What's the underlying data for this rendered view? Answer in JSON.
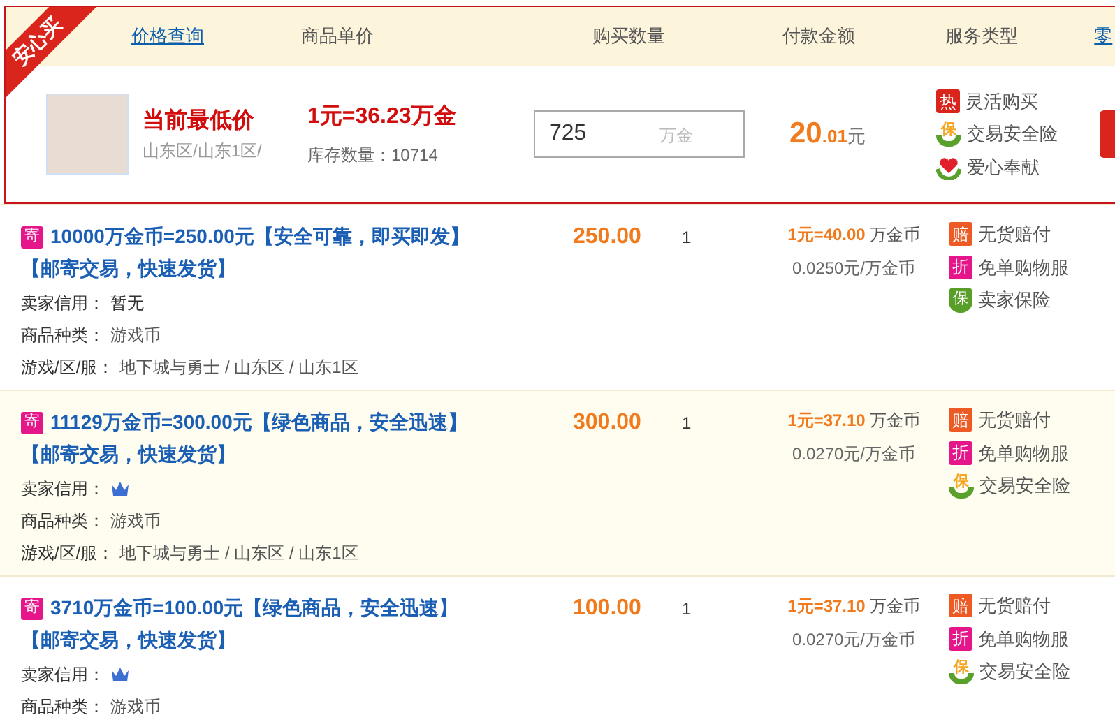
{
  "ribbon": "安心买",
  "header": {
    "columns": [
      {
        "label": "价格查询",
        "kind": "link"
      },
      {
        "label": "商品单价",
        "kind": "text"
      },
      {
        "label": "购买数量",
        "kind": "text"
      },
      {
        "label": "付款金额",
        "kind": "text"
      },
      {
        "label": "服务类型",
        "kind": "text"
      },
      {
        "label": "零",
        "kind": "link"
      }
    ]
  },
  "best_offer": {
    "title": "当前最低价",
    "region": "山东区/山东1区/",
    "rate": "1元=36.23万金",
    "stock_label": "库存数量：",
    "stock": "10714",
    "quantity": {
      "value": "725",
      "suffix": "万金"
    },
    "amount_integer": "20",
    "amount_decimal": ".01",
    "amount_unit": "元",
    "services": [
      {
        "kind": "square",
        "badge": "热",
        "color": "#d9251c",
        "label": "灵活购买"
      },
      {
        "kind": "hands",
        "badge": "保",
        "color": "#f5a623",
        "label": "交易安全险"
      },
      {
        "kind": "heart",
        "color": "#e0202a",
        "label": "爱心奉献"
      }
    ]
  },
  "listings": [
    {
      "badge": "寄",
      "title_lines": [
        "10000万金币=250.00元【安全可靠，即买即发】",
        "【邮寄交易，快速发货】"
      ],
      "credit_label": "卖家信用：",
      "credit": {
        "kind": "text",
        "text": "暂无"
      },
      "category_label": "商品种类：",
      "category": "游戏币",
      "server_label": "游戏/区/服：",
      "server": "地下城与勇士 / 山东区 / 山东1区",
      "price": "250.00",
      "quantity": "1",
      "rate_value": "1元=40.00",
      "rate_unit": "万金币",
      "unit_price": "0.0250元/万金币",
      "highlighted": false,
      "services": [
        {
          "kind": "square",
          "badge": "赔",
          "color": "#ee5a24",
          "label": "无货赔付"
        },
        {
          "kind": "square",
          "badge": "折",
          "color": "#e4168a",
          "label": "免单购物服"
        },
        {
          "kind": "shield",
          "badge": "保",
          "color": "#5a9e2a",
          "label": "卖家保险"
        }
      ]
    },
    {
      "badge": "寄",
      "title_lines": [
        "11129万金币=300.00元【绿色商品，安全迅速】",
        "【邮寄交易，快速发货】"
      ],
      "credit_label": "卖家信用：",
      "credit": {
        "kind": "crown"
      },
      "category_label": "商品种类：",
      "category": "游戏币",
      "server_label": "游戏/区/服：",
      "server": "地下城与勇士 / 山东区 / 山东1区",
      "price": "300.00",
      "quantity": "1",
      "rate_value": "1元=37.10",
      "rate_unit": "万金币",
      "unit_price": "0.0270元/万金币",
      "highlighted": true,
      "services": [
        {
          "kind": "square",
          "badge": "赔",
          "color": "#ee5a24",
          "label": "无货赔付"
        },
        {
          "kind": "square",
          "badge": "折",
          "color": "#e4168a",
          "label": "免单购物服"
        },
        {
          "kind": "hands",
          "badge": "保",
          "color": "#f5a623",
          "label": "交易安全险"
        }
      ]
    },
    {
      "badge": "寄",
      "title_lines": [
        "3710万金币=100.00元【绿色商品，安全迅速】",
        "【邮寄交易，快速发货】"
      ],
      "credit_label": "卖家信用：",
      "credit": {
        "kind": "crown"
      },
      "category_label": "商品种类：",
      "category": "游戏币",
      "price": "100.00",
      "quantity": "1",
      "rate_value": "1元=37.10",
      "rate_unit": "万金币",
      "unit_price": "0.0270元/万金币",
      "highlighted": false,
      "services": [
        {
          "kind": "square",
          "badge": "赔",
          "color": "#ee5a24",
          "label": "无货赔付"
        },
        {
          "kind": "square",
          "badge": "折",
          "color": "#e4168a",
          "label": "免单购物服"
        },
        {
          "kind": "hands",
          "badge": "保",
          "color": "#f5a623",
          "label": "交易安全险"
        }
      ]
    }
  ]
}
